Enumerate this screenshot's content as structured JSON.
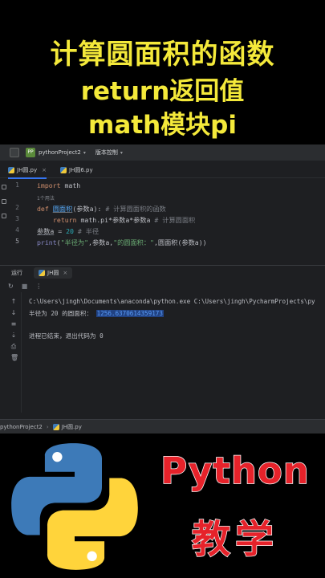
{
  "banner": {
    "line1": "计算圆面积的函数",
    "line2": "return返回值",
    "line3": "math模块pi"
  },
  "ide": {
    "titlebar": {
      "project_badge": "PP",
      "project": "pythonProject2",
      "vcs": "版本控制"
    },
    "tabs": [
      {
        "label": "JH圆.py",
        "active": true
      },
      {
        "label": "JH圆6.py",
        "active": false
      }
    ],
    "code": {
      "line_numbers": [
        "1",
        "2",
        "3",
        "4",
        "5"
      ],
      "usages_hint": "1个用法",
      "line1": {
        "kw": "import",
        "rest": " math"
      },
      "line2": {
        "kw": "def",
        "fn": "圆面积",
        "params": "(参数a):",
        "comment": " # 计算圆面积的函数"
      },
      "line3": {
        "kw": "return",
        "expr": " math.pi*参数a*参数a",
        "comment": " # 计算圆面积"
      },
      "line4": {
        "var": "参数a",
        "op": " = ",
        "num": "20",
        "comment": " # 半径"
      },
      "line5": {
        "bi": "print",
        "p1": "(",
        "s1": "\"半径为\"",
        "p2": ",参数a,",
        "s2": "\"的圆面积：\"",
        "p3": ",圆面积(参数a))"
      }
    },
    "run": {
      "label": "运行",
      "tab": "JH圆"
    },
    "console": {
      "command": "C:\\Users\\jingh\\Documents\\anaconda\\python.exe C:\\Users\\jingh\\PycharmProjects\\py",
      "output_prefix": "半径为 20 的圆面积：",
      "output_value": "1256.6370614359173",
      "exit": "进程已结束，退出代码为 0"
    },
    "statusbar": {
      "project": "pythonProject2",
      "file": "JH圆.py"
    }
  },
  "promo": {
    "title": "Python",
    "subtitle": "教学"
  },
  "colors": {
    "banner_text": "#f4e93a",
    "promo_text": "#e6222a",
    "python_blue": "#3d7ab8",
    "python_yellow": "#ffd43b",
    "result_highlight": "#5a9cf8"
  }
}
